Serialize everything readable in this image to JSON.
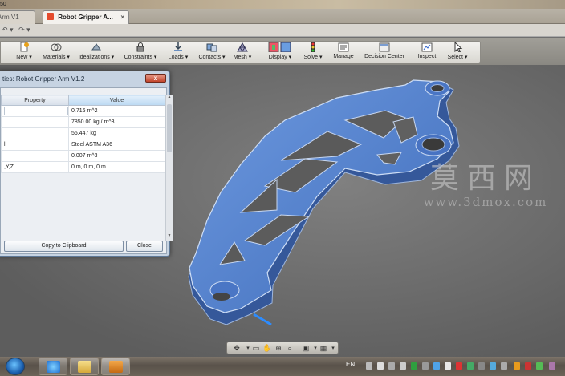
{
  "titlebar": {
    "partial_title": "50"
  },
  "tabs": [
    {
      "label": "Arm V1"
    },
    {
      "label": "Robot Gripper A...",
      "close": "×"
    }
  ],
  "quickbar": {
    "undo": "↶ ▾",
    "redo": "↷ ▾"
  },
  "ribbon": {
    "buttons": [
      {
        "label": "New ▾",
        "icon": "new-icon"
      },
      {
        "label": "Materials ▾",
        "icon": "materials-icon"
      },
      {
        "label": "Idealizations ▾",
        "icon": "idealizations-icon"
      },
      {
        "label": "Constraints ▾",
        "icon": "constraints-icon"
      },
      {
        "label": "Loads ▾",
        "icon": "loads-icon"
      },
      {
        "label": "Contacts ▾",
        "icon": "contacts-icon"
      },
      {
        "label": "Mesh ▾",
        "icon": "mesh-icon"
      },
      {
        "label": "Display ▾",
        "icon": "display-icon"
      },
      {
        "label": "Solve ▾",
        "icon": "solve-icon"
      },
      {
        "label": "Manage",
        "icon": "manage-icon"
      },
      {
        "label": "Decision Center",
        "icon": "decision-center-icon"
      },
      {
        "label": "Inspect",
        "icon": "inspect-icon"
      },
      {
        "label": "Select ▾",
        "icon": "select-icon"
      }
    ]
  },
  "dialog": {
    "title": "ties: Robot Gripper Arm V1.2",
    "close_glyph": "x",
    "columns": [
      "Property",
      "Value"
    ],
    "rows": [
      {
        "property": "",
        "value": "0.716 m^2"
      },
      {
        "property": "",
        "value": "7850.00 kg / m^3"
      },
      {
        "property": "",
        "value": "56.447 kg"
      },
      {
        "property": "l",
        "value": "Steel ASTM A36"
      },
      {
        "property": "",
        "value": "0.007 m^3"
      },
      {
        "property": ",Y,Z",
        "value": "0 m, 0 m, 0 m"
      }
    ],
    "copy_button": "Copy to Clipboard",
    "close_button": "Close"
  },
  "watermark": {
    "big": "莫西网",
    "small": "www.3dmox.com"
  },
  "navbar": {
    "icons": [
      "orbit-icon",
      "look-at-icon",
      "pan-icon",
      "zoom-icon",
      "zoom-window-icon",
      "display-mode-icon",
      "grid-icon"
    ]
  },
  "taskbar": {
    "language": "EN",
    "apps": [
      "internet-explorer-icon",
      "explorer-folder-icon",
      "simulation-app-icon"
    ]
  },
  "colors": {
    "part_blue": "#4f7fce",
    "part_edge": "#b9cfee",
    "ribbon": "#e8e6e1",
    "viewport": "#6f6f6f"
  }
}
